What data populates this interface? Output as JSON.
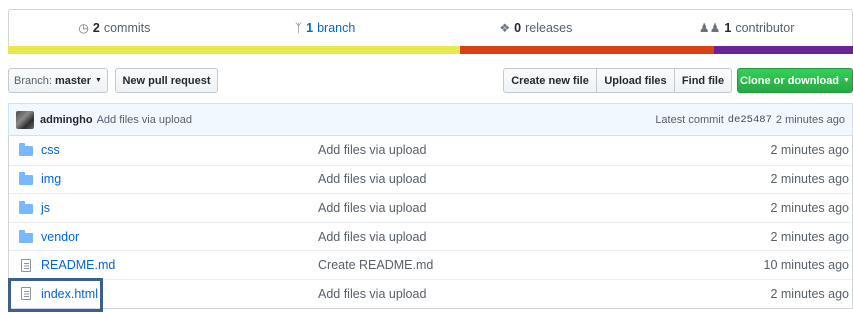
{
  "summary": {
    "commits_count": "2",
    "commits_label": "commits",
    "branches_count": "1",
    "branches_label": "branch",
    "releases_count": "0",
    "releases_label": "releases",
    "contributors_count": "1",
    "contributors_label": "contributor"
  },
  "language_bar": [
    {
      "color": "#e7e94e",
      "share": 0.535
    },
    {
      "color": "#dc3f12",
      "share": 0.3
    },
    {
      "color": "#6a2393",
      "share": 0.165
    }
  ],
  "toolbar": {
    "branch_prefix": "Branch:",
    "branch_name": "master",
    "new_pull_request": "New pull request",
    "create_new_file": "Create new file",
    "upload_files": "Upload files",
    "find_file": "Find file",
    "clone_or_download": "Clone or download"
  },
  "latest_commit": {
    "author": "admingho",
    "message": "Add files via upload",
    "label": "Latest commit",
    "sha": "de25487",
    "age": "2 minutes ago"
  },
  "files": [
    {
      "type": "dir",
      "name": "css",
      "message": "Add files via upload",
      "age": "2 minutes ago"
    },
    {
      "type": "dir",
      "name": "img",
      "message": "Add files via upload",
      "age": "2 minutes ago"
    },
    {
      "type": "dir",
      "name": "js",
      "message": "Add files via upload",
      "age": "2 minutes ago"
    },
    {
      "type": "dir",
      "name": "vendor",
      "message": "Add files via upload",
      "age": "2 minutes ago"
    },
    {
      "type": "file",
      "name": "README.md",
      "message": "Create README.md",
      "age": "10 minutes ago"
    },
    {
      "type": "file",
      "name": "index.html",
      "message": "Add files via upload",
      "age": "2 minutes ago"
    }
  ]
}
